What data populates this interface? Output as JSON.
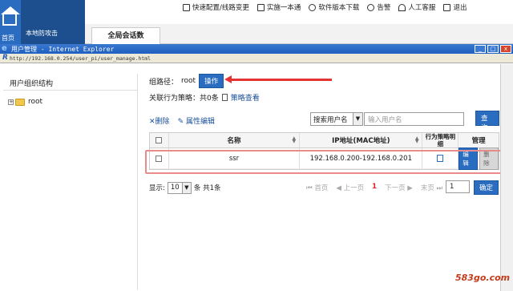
{
  "app": {
    "home_label": "首页",
    "left_label": "本地防攻击",
    "menu": [
      {
        "label": "快速配置/线路变更",
        "icon": "lightning-icon"
      },
      {
        "label": "实施一本通",
        "icon": "book-icon"
      },
      {
        "label": "软件版本下载",
        "icon": "download-icon"
      },
      {
        "label": "告警",
        "icon": "bell-icon"
      },
      {
        "label": "人工客服",
        "icon": "user-icon"
      },
      {
        "label": "退出",
        "icon": "exit-icon"
      }
    ],
    "active_tab": "全局会话数"
  },
  "ie": {
    "title": "用户管理 - Internet Explorer",
    "url": "http://192.168.0.254/user_pi/user_manage.html"
  },
  "left": {
    "header": "用户组织结构",
    "tree": [
      {
        "label": "root"
      }
    ]
  },
  "main": {
    "group_path_label": "组路径：",
    "group_path_value": "root",
    "operate_button": "操作",
    "policy_label": "关联行为策略：共0条",
    "policy_link": "策略查看",
    "delete_link": "删除",
    "attr_edit_link": "属性编辑",
    "search_type": "搜索用户名",
    "search_placeholder": "输入用户名",
    "query_button": "查询",
    "columns": [
      "名称",
      "IP地址(MAC地址)",
      "行为策略明细",
      "管理"
    ],
    "rows": [
      {
        "name": "ssr",
        "ip": "192.168.0.200-192.168.0.201",
        "edit": "编辑",
        "delete": "删除"
      }
    ],
    "pager": {
      "show_label": "显示:",
      "page_size": "10",
      "summary": "条 共1条",
      "first": "首页",
      "prev": "上一页",
      "current": "1",
      "next": "下一页",
      "last": "末页",
      "jump_value": "1",
      "confirm": "确定"
    }
  },
  "watermark": "583go.com",
  "colors": {
    "accent": "#2a6cbf",
    "highlight_arrow": "#e53232",
    "row_highlight": "#e98b8b"
  }
}
